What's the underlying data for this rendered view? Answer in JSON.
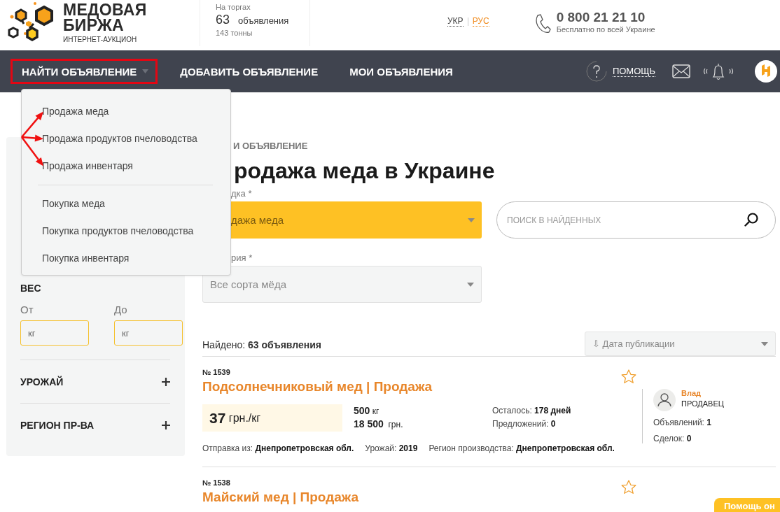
{
  "logo": {
    "title_line1": "МЕДОВАЯ",
    "title_line2": "БИРЖА",
    "subtitle": "ИНТЕРНЕТ-АУКЦИОН"
  },
  "stats": {
    "caption": "На торгах",
    "count": "63",
    "count_label": "объявления",
    "volume": "143 тонны"
  },
  "languages": [
    {
      "label": "УКР",
      "selected": false
    },
    {
      "label": "РУС",
      "selected": true
    }
  ],
  "phone": {
    "number": "0 800 21 21 10",
    "note": "Бесплатно по всей Украине"
  },
  "nav": [
    {
      "label": "НАЙТИ ОБЪЯВЛЕНИЕ",
      "highlighted": true,
      "has_menu": true
    },
    {
      "label": "ДОБАВИТЬ ОБЪЯВЛЕНИЕ",
      "highlighted": false,
      "has_menu": false
    },
    {
      "label": "МОИ ОБЪЯВЛЕНИЯ",
      "highlighted": false,
      "has_menu": false
    }
  ],
  "help": {
    "label": "ПОМОЩЬ"
  },
  "dropdown": [
    [
      {
        "label": "Продажа меда",
        "arrow": true
      },
      {
        "label": "Продажа продуктов пчеловодства",
        "arrow": true
      },
      {
        "label": "Продажа инвентаря",
        "arrow": true
      }
    ],
    [
      {
        "label": "Покупка меда",
        "arrow": false
      },
      {
        "label": "Покупка продуктов пчеловодства",
        "arrow": false
      },
      {
        "label": "Покупка инвентаря",
        "arrow": false
      }
    ]
  ],
  "filters": {
    "weight": {
      "title": "ВЕС",
      "from_label": "От",
      "to_label": "До",
      "from_placeholder": "кг",
      "to_placeholder": "кг"
    },
    "sections": [
      {
        "title": "УРОЖАЙ",
        "expanded": false
      },
      {
        "title": "РЕГИОН ПР-ВА",
        "expanded": false
      }
    ]
  },
  "breadcrumb": "И ОБЪЯВЛЕНИЕ",
  "heading": "родажа меда в Украине",
  "type_select": {
    "label": "дка *",
    "value": "дажа меда"
  },
  "search": {
    "placeholder": "ПОИСК В НАЙДЕННЫХ"
  },
  "category_select": {
    "label": "рия *",
    "value": "Все сорта мёда"
  },
  "found": {
    "label": "Найдено:",
    "value": "63 объявления"
  },
  "sort": {
    "value": "⇩ Дата публикации"
  },
  "listings": [
    {
      "number": "№ 1539",
      "title": "Подсолнечниковый мед | Продажа",
      "favorite": false,
      "price": "37",
      "price_unit": "грн./кг",
      "amount": "500",
      "amount_unit": "кг",
      "total": "18 500",
      "total_unit": "грн.",
      "remaining_label": "Осталось:",
      "remaining": "178 дней",
      "offers_label": "Предложений:",
      "offers": "0",
      "ship_label": "Отправка из:",
      "ship": "Днепропетровская обл.",
      "harvest_label": "Урожай:",
      "harvest": "2019",
      "region_label": "Регион производства:",
      "region": "Днепропетровская обл.",
      "seller": {
        "name": "Влад",
        "role": "ПРОДАВЕЦ",
        "ads_label": "Объявлений:",
        "ads": "1",
        "deals_label": "Сделок:",
        "deals": "0"
      }
    },
    {
      "number": "№ 1538",
      "title": "Майский мед | Продажа",
      "favorite": false
    }
  ],
  "help_tab": {
    "label": "Помощь он"
  }
}
